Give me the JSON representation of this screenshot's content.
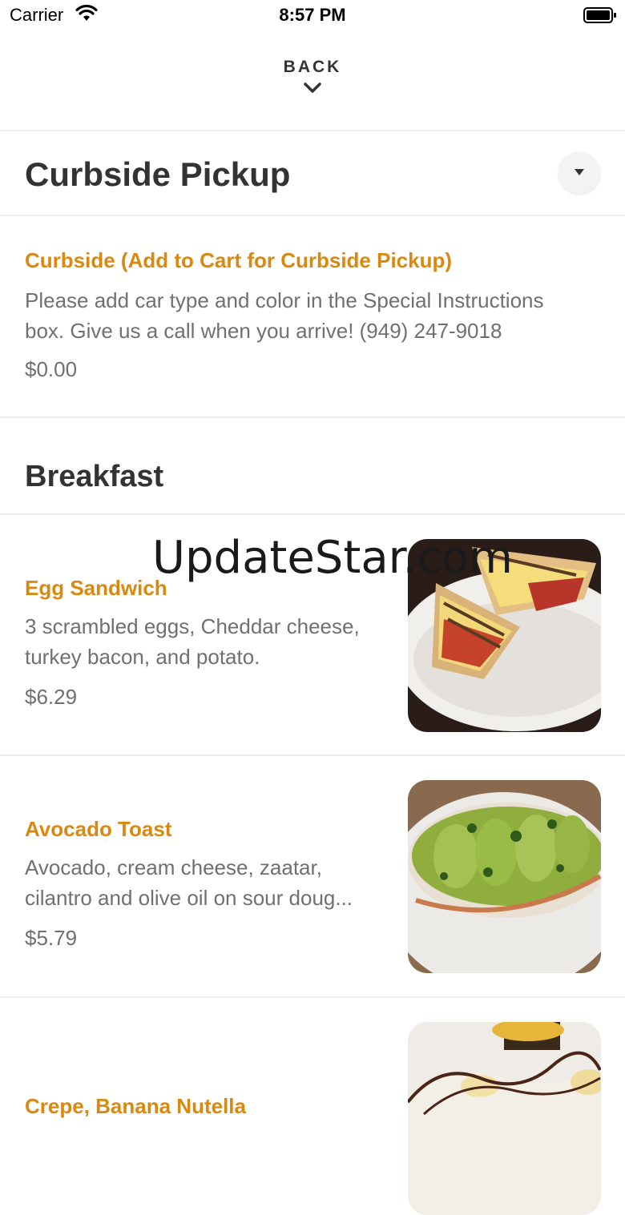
{
  "status_bar": {
    "carrier": "Carrier",
    "time": "8:57 PM"
  },
  "nav": {
    "back_label": "BACK"
  },
  "curbside": {
    "title": "Curbside Pickup",
    "item": {
      "name": "Curbside (Add to Cart for Curbside Pickup)",
      "description": "Please add car type and color in the Special Instructions box. Give us a call when you arrive! (949) 247-9018",
      "price": "$0.00"
    }
  },
  "breakfast": {
    "title": "Breakfast",
    "items": [
      {
        "name": "Egg Sandwich",
        "description": "3 scrambled eggs, Cheddar cheese, turkey bacon, and potato.",
        "price": "$6.29"
      },
      {
        "name": "Avocado Toast",
        "description": "Avocado, cream cheese, zaatar, cilantro and olive oil on sour doug...",
        "price": "$5.79"
      },
      {
        "name": "Crepe, Banana Nutella"
      }
    ]
  },
  "watermark": "UpdateStar.com",
  "colors": {
    "accent": "#d9890f",
    "text": "#333333",
    "muted": "#707070",
    "divider": "#ececec"
  }
}
